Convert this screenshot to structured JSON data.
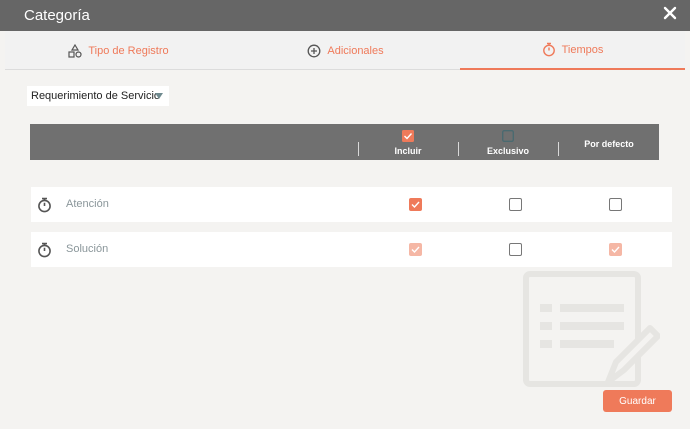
{
  "window": {
    "title": "Categoría",
    "close_icon": "close-icon"
  },
  "tabs": [
    {
      "label": "Tipo de Registro",
      "icon": "shapes-icon",
      "active": false
    },
    {
      "label": "Adicionales",
      "icon": "plus-circle-icon",
      "active": false
    },
    {
      "label": "Tiempos",
      "icon": "stopwatch-icon",
      "active": true
    }
  ],
  "dropdown": {
    "selected": "Requerimiento de Servicio"
  },
  "table": {
    "columns": [
      "Incluir",
      "Exclusivo",
      "Por defecto"
    ],
    "rows": [
      {
        "name": "Atención",
        "icon": "stopwatch-icon",
        "incluir": true,
        "exclusivo": false,
        "por_defecto": false
      },
      {
        "name": "Solución",
        "icon": "stopwatch-icon",
        "incluir": true,
        "exclusivo": false,
        "por_defecto": true
      }
    ]
  },
  "footer": {
    "save_label": "Guardar"
  },
  "colors": {
    "accent": "#ef7a5a",
    "header": "#666666",
    "table_header": "#707070",
    "background": "#f4f3f1"
  }
}
